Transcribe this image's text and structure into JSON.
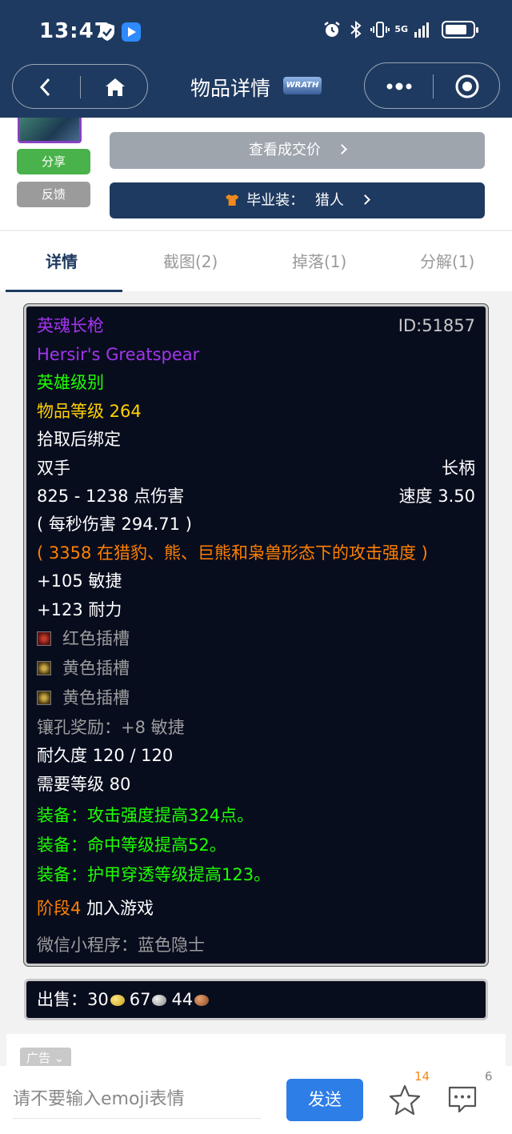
{
  "status_bar": {
    "time": "13:47",
    "network": "5G"
  },
  "nav": {
    "title": "物品详情",
    "badge": "WRATH"
  },
  "actions": {
    "share_label": "分享",
    "feedback_label": "反馈",
    "price_label": "查看成交价",
    "bis_label": "毕业装：",
    "bis_class": "猎人"
  },
  "tabs": [
    {
      "label": "详情"
    },
    {
      "label": "截图(2)"
    },
    {
      "label": "掉落(1)"
    },
    {
      "label": "分解(1)"
    }
  ],
  "item": {
    "name_cn": "英魂长枪",
    "id": "ID:51857",
    "name_en": "Hersir's Greatspear",
    "quality": "英雄级别",
    "item_level": "物品等级 264",
    "binding": "拾取后绑定",
    "slot": "双手",
    "type": "长柄",
    "damage": "825 - 1238 点伤害",
    "speed": "速度 3.50",
    "dps": "( 每秒伤害 294.71 )",
    "feral_ap": "( 3358 在猎豹、熊、巨熊和枭兽形态下的攻击强度 )",
    "agility": "+105 敏捷",
    "stamina": "+123 耐力",
    "socket_red": "红色插槽",
    "socket_yellow_1": "黄色插槽",
    "socket_yellow_2": "黄色插槽",
    "socket_bonus": "镶孔奖励：+8 敏捷",
    "durability": "耐久度 120 / 120",
    "req_level": "需要等级 80",
    "equip_1": "装备：攻击强度提高324点。",
    "equip_2": "装备：命中等级提高52。",
    "equip_3": "装备：护甲穿透等级提高123。",
    "phase": "阶段4",
    "phase_suffix": "加入游戏",
    "source": "微信小程序：蓝色隐士"
  },
  "sell": {
    "label": "出售：",
    "gold": "30",
    "silver": "67",
    "copper": "44"
  },
  "ad": {
    "label": "广告"
  },
  "bottom": {
    "input_placeholder": "请不要输入emoji表情",
    "send_label": "发送",
    "star_count": "14",
    "comment_count": "6"
  },
  "colors": {
    "nav_bg": "#1f3a60",
    "epic": "#a335ee",
    "green": "#1eff00",
    "yellow": "#ffd100",
    "orange": "#ff8000",
    "send": "#2e7ee8"
  },
  "battery_level": 0.8
}
